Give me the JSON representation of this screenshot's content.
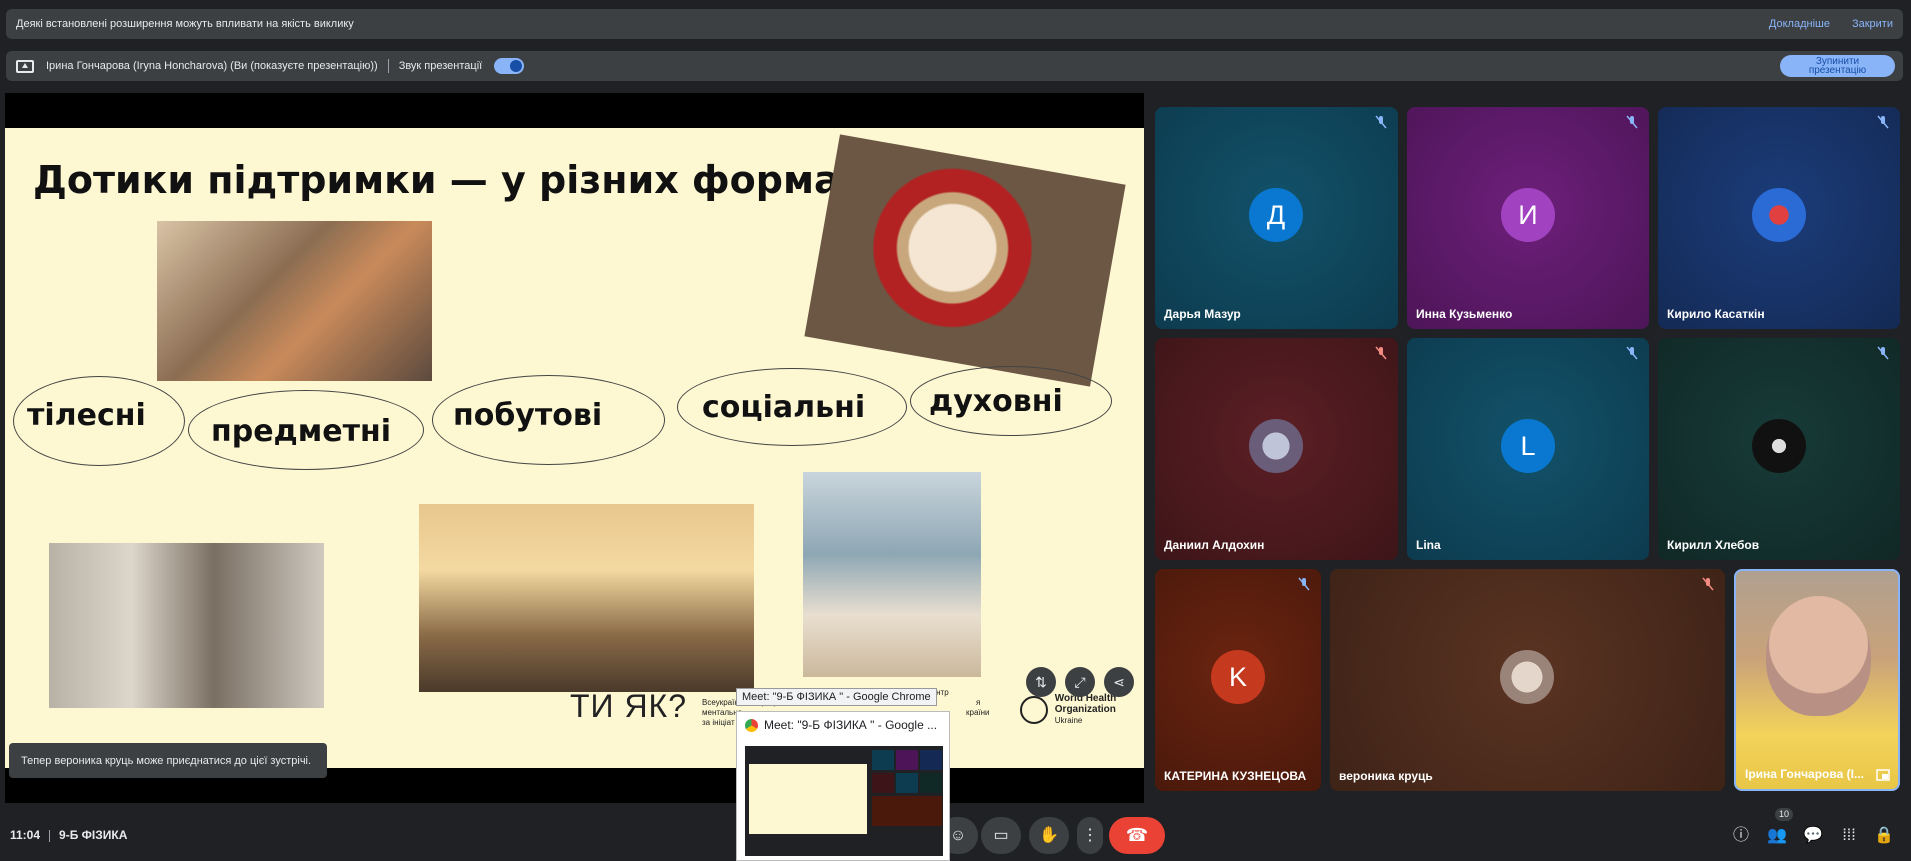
{
  "notice": {
    "message": "Деякі встановлені розширення можуть впливати на якість виклику",
    "more_link": "Докладніше",
    "close_link": "Закрити"
  },
  "presenter": {
    "name": "Ірина Гончарова (Iryna Honcharova) (Ви (показуєте презентацію))",
    "audio_label": "Звук презентації",
    "audio_on": true,
    "stop_button_line1": "Зупинити",
    "stop_button_line2": "презентацію"
  },
  "slide": {
    "title": "Дотики підтримки — у різних формах",
    "words": [
      "тілесні",
      "предметні",
      "побутові",
      "соціальні",
      "духовні"
    ],
    "footer_logo": "ТИ ЯК?",
    "footer_text1": "Всеукраїнська програма",
    "footer_text2": "ментально",
    "footer_text3": "за ініціат",
    "footer_text4": "координаційний центр",
    "footer_text5": "я",
    "footer_text6": "країни",
    "who_line1": "World Health",
    "who_line2": "Organization",
    "who_line3": "Ukraine"
  },
  "toast": "Тепер вероника круць може приєднатися до цієї зустрічі.",
  "participants": [
    {
      "name": "Дарья Мазур",
      "initial": "Д",
      "muted": true
    },
    {
      "name": "Инна Кузьменко",
      "initial": "И",
      "muted": true
    },
    {
      "name": "Кирило Касаткін",
      "initial": "",
      "muted": true
    },
    {
      "name": "Даниил Алдохин",
      "initial": "",
      "muted": true
    },
    {
      "name": "Lina",
      "initial": "L",
      "muted": true
    },
    {
      "name": "Кирилл Хлебов",
      "initial": "",
      "muted": true
    },
    {
      "name": "КАТЕРИНА КУЗНЕЦОВА",
      "initial": "K",
      "muted": true
    },
    {
      "name": "вероника круць",
      "initial": "",
      "muted": true
    },
    {
      "name": "Ірина Гончарова (І...",
      "initial": "",
      "muted": false
    }
  ],
  "bottom": {
    "time": "11:04",
    "meeting_name": "9-Б ФІЗИКА",
    "participant_count": "10"
  },
  "taskbar": {
    "tooltip": "Meet: \"9-Б ФІЗИКА \" - Google Chrome",
    "preview_title": "Meet: \"9-Б ФІЗИКА \" - Google ..."
  },
  "colors": {
    "accent": "#8ab4f8",
    "end_call": "#ea4335",
    "panel": "#3c4043",
    "slide_bg": "#fdf7d2"
  }
}
